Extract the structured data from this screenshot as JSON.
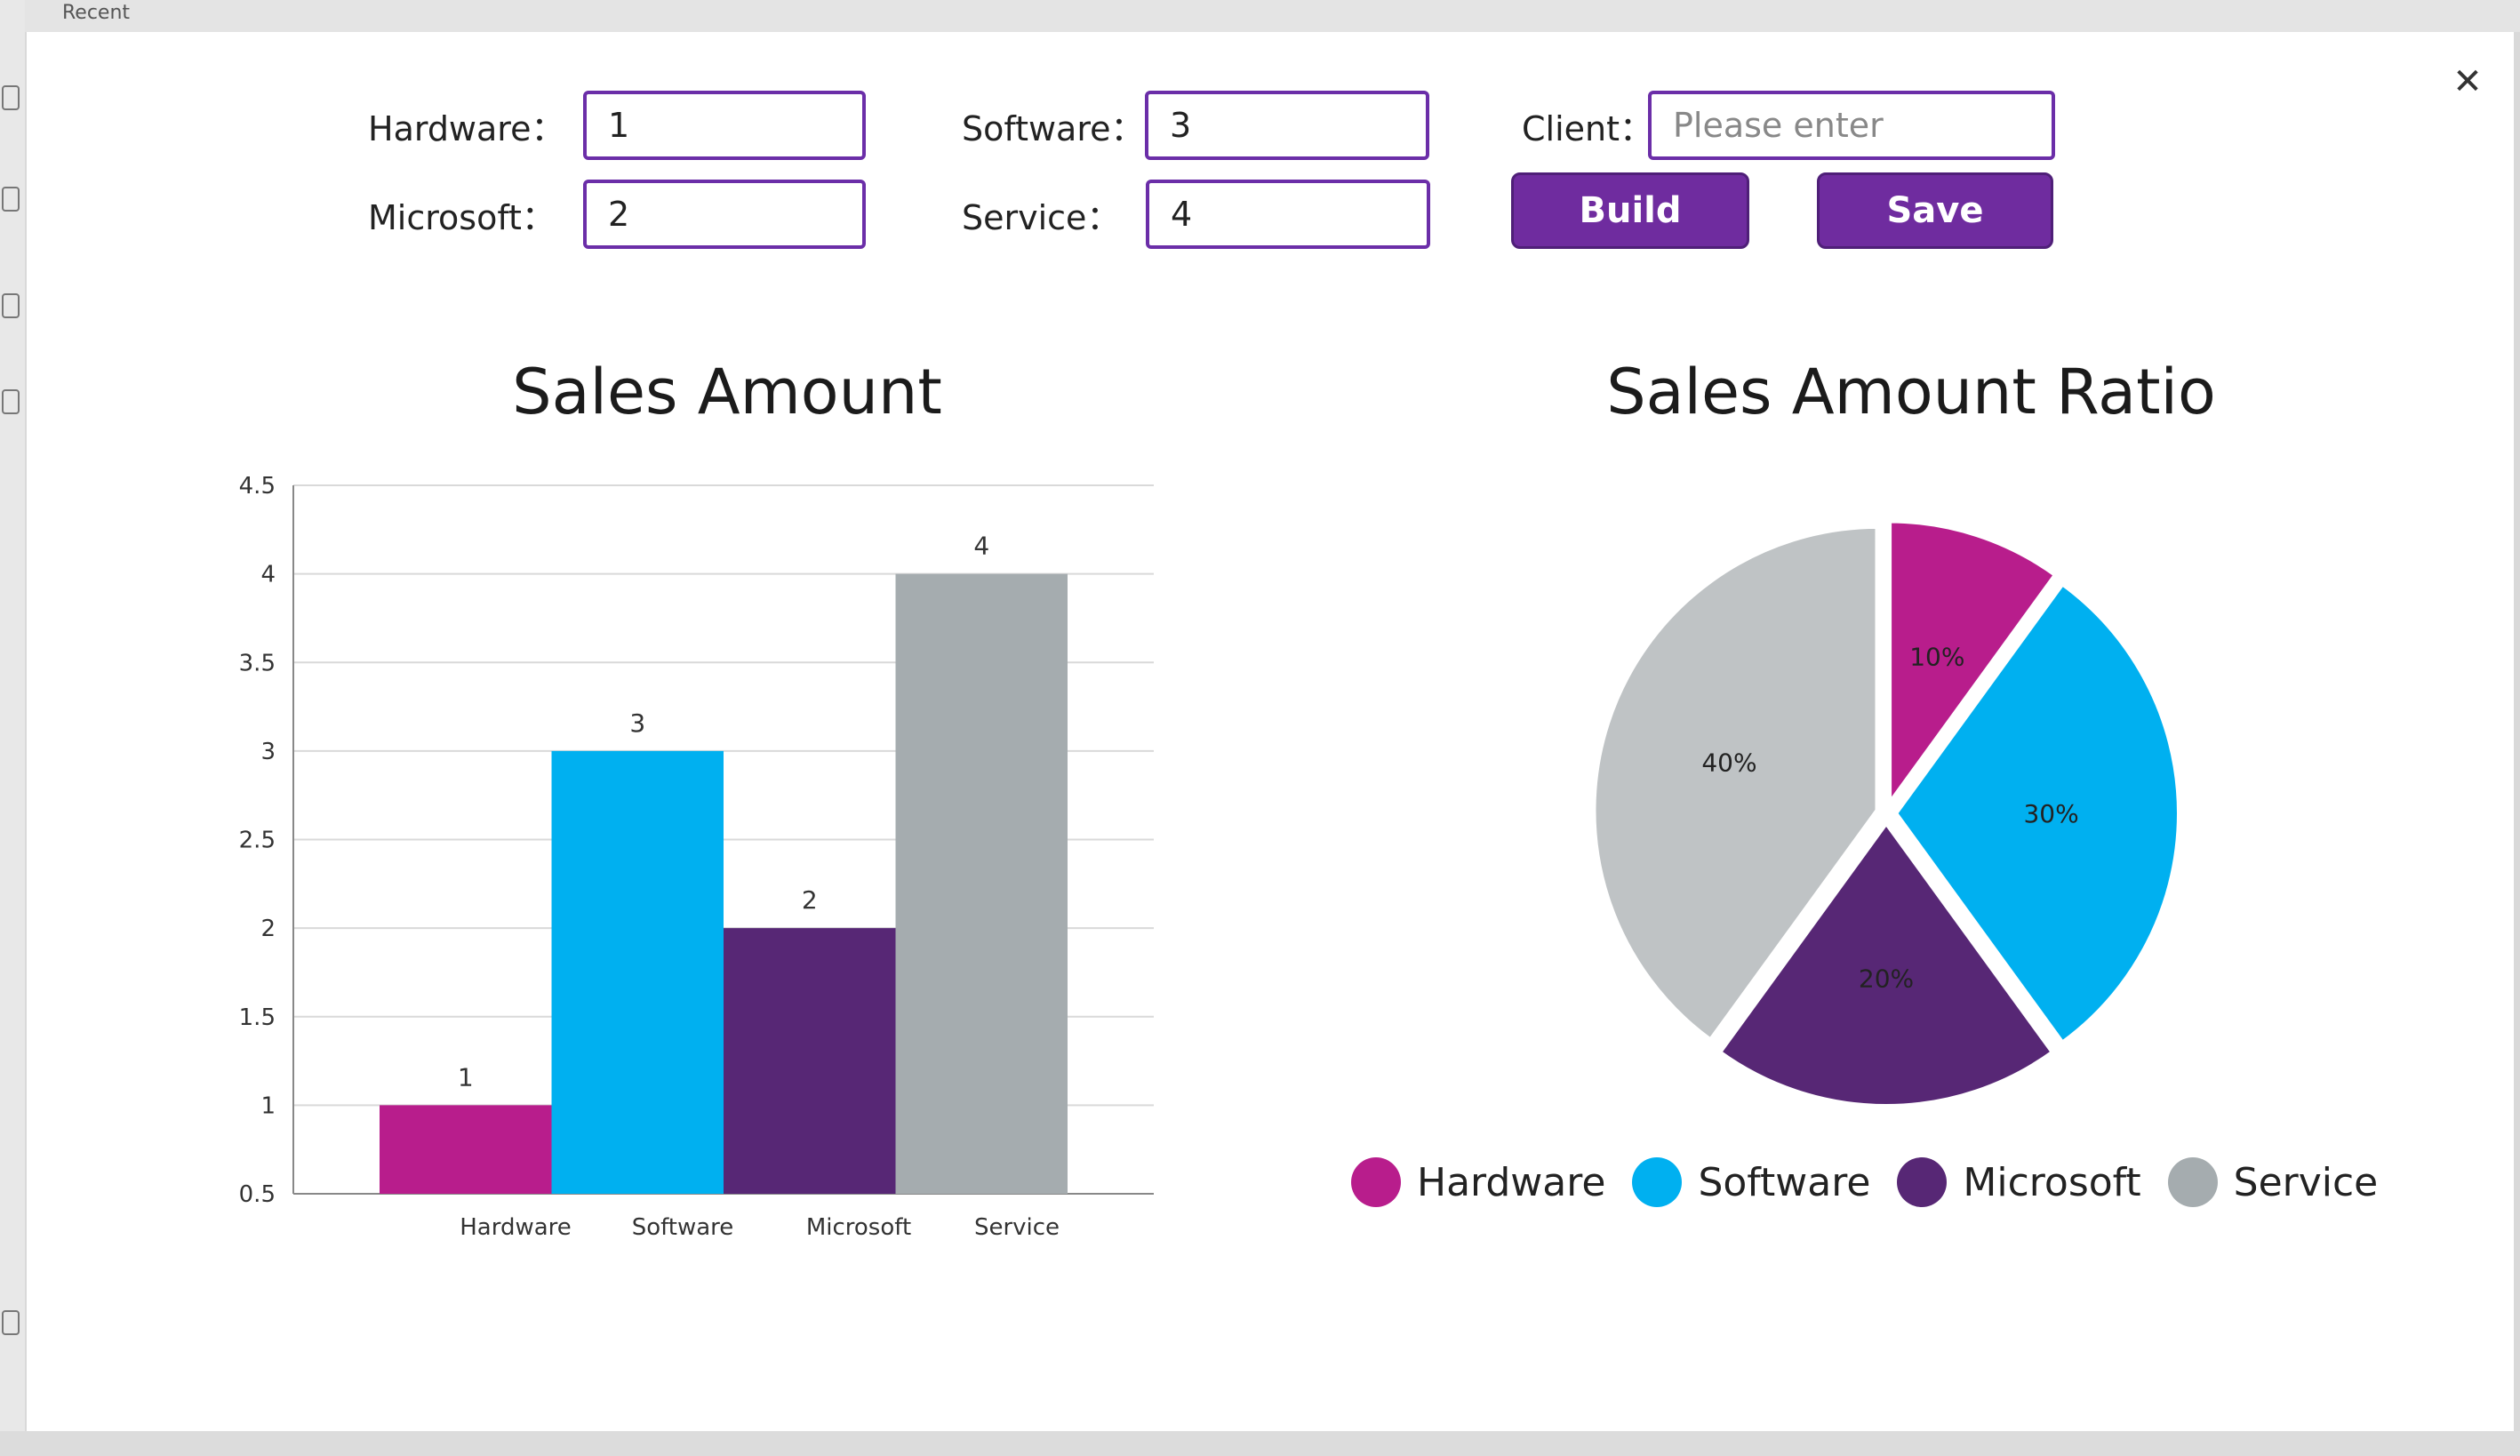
{
  "background": {
    "recent_label": "Recent"
  },
  "dialog": {
    "close_icon": "close-icon",
    "close_glyph": "✕"
  },
  "form": {
    "hardware": {
      "label": "Hardware：",
      "value": "1"
    },
    "microsoft": {
      "label": "Microsoft：",
      "value": "2"
    },
    "software": {
      "label": "Software：",
      "value": "3"
    },
    "service": {
      "label": "Service：",
      "value": "4"
    },
    "client": {
      "label": "Client：",
      "value": "",
      "placeholder": "Please enter"
    },
    "build_label": "Build",
    "save_label": "Save"
  },
  "colors": {
    "hardware": "#b81d8c",
    "software": "#00b0f0",
    "microsoft": "#572775",
    "service": "#a5acaf",
    "service_pie": "#bfc3c5",
    "accent": "#6f2c9f"
  },
  "chart_data": [
    {
      "type": "bar",
      "title": "Sales Amount",
      "categories": [
        "Hardware",
        "Software",
        "Microsoft",
        "Service"
      ],
      "values": [
        1,
        3,
        2,
        4
      ],
      "data_labels": [
        "1",
        "3",
        "2",
        "4"
      ],
      "ylim": [
        0.5,
        4.5
      ],
      "yticks": [
        0.5,
        1,
        1.5,
        2,
        2.5,
        3,
        3.5,
        4,
        4.5
      ],
      "ytick_labels": [
        "0.5",
        "1",
        "1.5",
        "2",
        "2.5",
        "3",
        "3.5",
        "4",
        "4.5"
      ],
      "grid": true,
      "xlabel": "",
      "ylabel": ""
    },
    {
      "type": "pie",
      "title": "Sales Amount Ratio",
      "categories": [
        "Hardware",
        "Software",
        "Microsoft",
        "Service"
      ],
      "values": [
        10,
        30,
        20,
        40
      ],
      "data_labels": [
        "10%",
        "30%",
        "20%",
        "40%"
      ],
      "legend_position": "bottom"
    }
  ]
}
